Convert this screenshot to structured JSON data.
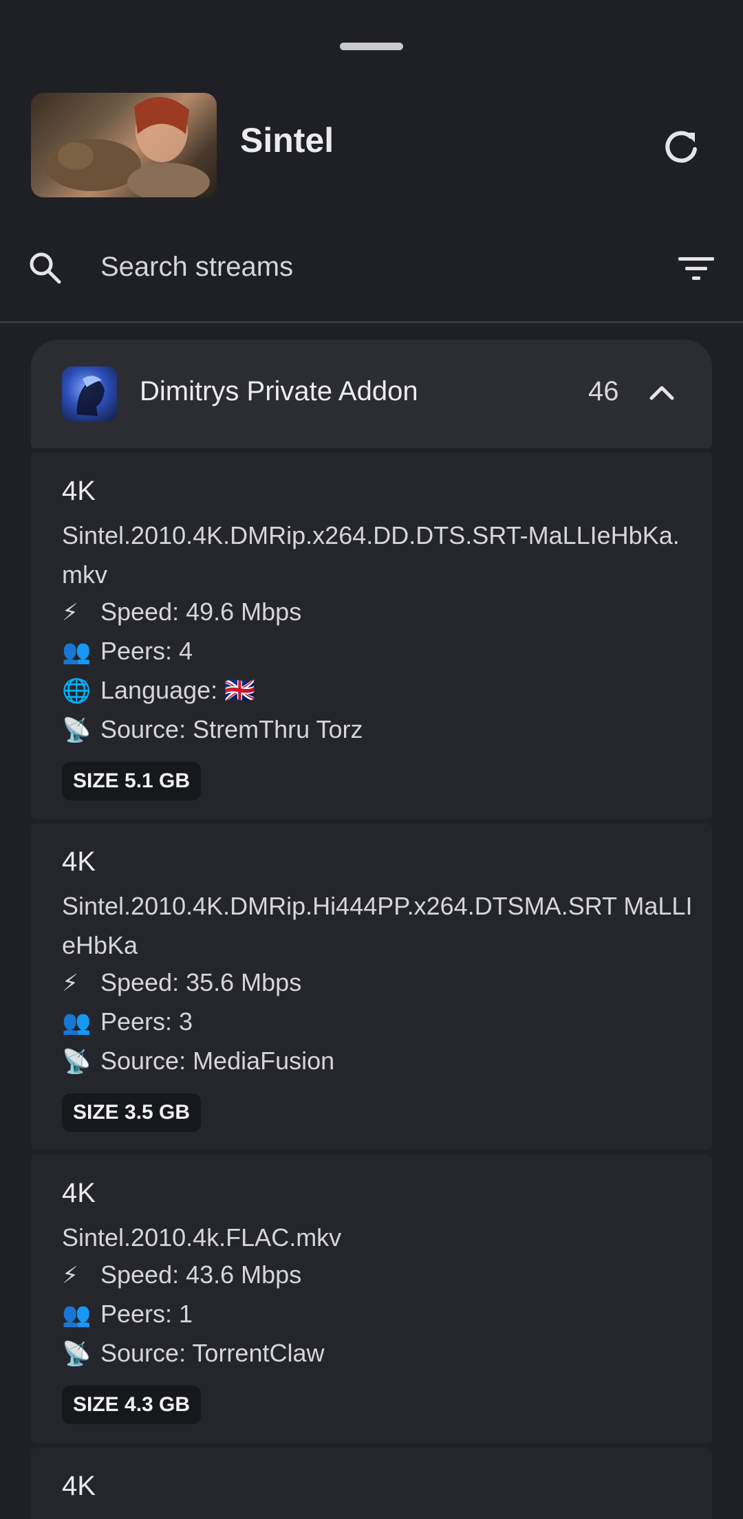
{
  "header": {
    "title": "Sintel"
  },
  "search": {
    "placeholder": "Search streams"
  },
  "group": {
    "name": "Dimitrys Private Addon",
    "count": "46"
  },
  "streams": [
    {
      "quality": "4K",
      "filename": "Sintel.2010.4K.DMRip.x264.DD.DTS.SRT-MaLLIeHbKa.mkv",
      "speed": "Speed: 49.6 Mbps",
      "peers": "Peers: 4",
      "language": "Language: 🇬🇧",
      "source": "Source: StremThru Torz",
      "size": "SIZE 5.1 GB"
    },
    {
      "quality": "4K",
      "filename": "Sintel.2010.4K.DMRip.Hi444PP.x264.DTSMA.SRT MaLLIeHbKa",
      "speed": "Speed: 35.6 Mbps",
      "peers": "Peers: 3",
      "source": "Source: MediaFusion",
      "size": "SIZE 3.5 GB"
    },
    {
      "quality": "4K",
      "filename": "Sintel.2010.4k.FLAC.mkv",
      "speed": "Speed: 43.6 Mbps",
      "peers": "Peers: 1",
      "source": "Source: TorrentClaw",
      "size": "SIZE 4.3 GB"
    },
    {
      "quality": "4K"
    }
  ],
  "icons": {
    "speed": "⚡",
    "peers": "👥",
    "language": "🌐",
    "source": "📡"
  }
}
